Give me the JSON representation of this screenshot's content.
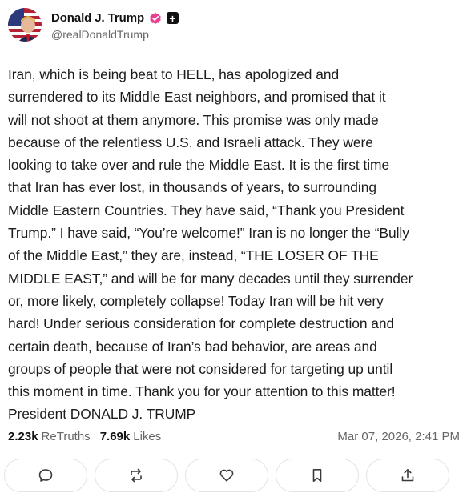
{
  "author": {
    "display_name": "Donald J. Trump",
    "handle": "@realDonaldTrump",
    "avatar_icon": "flag-portrait-avatar",
    "verified_icon": "verified-badge-icon",
    "verified_color": "#e8418f",
    "follow_label": "+"
  },
  "post": {
    "text": "Iran, which is being beat to HELL, has apologized and\nsurrendered to its Middle East neighbors, and promised that it\nwill not shoot at them anymore. This promise was only made\nbecause of the relentless U.S. and Israeli attack. They were\nlooking to take over and rule the Middle East. It is the first time\nthat Iran has ever lost, in thousands of years, to surrounding\nMiddle Eastern Countries. They have said, “Thank you President\nTrump.” I have said, “You’re welcome!” Iran is no longer the “Bully\nof the Middle East,” they are, instead, “THE LOSER OF THE\nMIDDLE EAST,” and will be for many decades until they surrender\nor, more likely, completely collapse! Today Iran will be hit very\nhard! Under serious consideration for complete destruction and\ncertain death, because of Iran’s bad behavior, are areas and\ngroups of people that were not considered for targeting up until\nthis moment in time. Thank you for your attention to this matter!\nPresident DONALD J. TRUMP"
  },
  "stats": {
    "retruths_count": "2.23k",
    "retruths_label": "ReTruths",
    "likes_count": "7.69k",
    "likes_label": "Likes",
    "timestamp": "Mar 07, 2026, 2:41 PM"
  },
  "actions": [
    {
      "name": "reply",
      "icon": "speech-bubble-icon"
    },
    {
      "name": "retruth",
      "icon": "repost-arrows-icon"
    },
    {
      "name": "like",
      "icon": "heart-icon"
    },
    {
      "name": "bookmark",
      "icon": "bookmark-icon"
    },
    {
      "name": "share",
      "icon": "share-upload-icon"
    }
  ]
}
